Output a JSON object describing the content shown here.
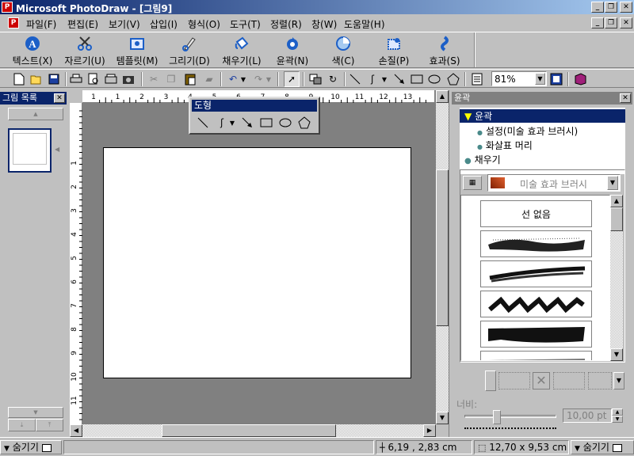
{
  "window": {
    "title": "Microsoft PhotoDraw - [그림9]",
    "app_icon_letter": "P"
  },
  "menu": {
    "items": [
      "파일(F)",
      "편집(E)",
      "보기(V)",
      "삽입(I)",
      "형식(O)",
      "도구(T)",
      "정렬(R)",
      "창(W)",
      "도움말(H)"
    ]
  },
  "big_toolbar": {
    "buttons": [
      {
        "label": "텍스트(X)",
        "icon": "text-A-icon"
      },
      {
        "label": "자르기(U)",
        "icon": "scissors-icon"
      },
      {
        "label": "템플릿(M)",
        "icon": "template-icon"
      },
      {
        "label": "그리기(D)",
        "icon": "pen-icon"
      },
      {
        "label": "채우기(L)",
        "icon": "paint-bucket-icon"
      },
      {
        "label": "윤곽(N)",
        "icon": "outline-icon"
      },
      {
        "label": "색(C)",
        "icon": "color-icon"
      },
      {
        "label": "손질(P)",
        "icon": "touchup-icon"
      },
      {
        "label": "효과(S)",
        "icon": "effects-icon"
      }
    ]
  },
  "std_toolbar": {
    "zoom": "81%"
  },
  "left_panel": {
    "title": "그림 목록"
  },
  "shapes_window": {
    "title": "도형"
  },
  "ruler": {
    "h_numbers": [
      "1",
      "1",
      "2",
      "3",
      "4",
      "5",
      "6",
      "7",
      "8",
      "9",
      "10",
      "11",
      "12",
      "13"
    ],
    "v_numbers": [
      "1",
      "2",
      "3",
      "4",
      "5",
      "6",
      "7",
      "8",
      "9",
      "10",
      "11"
    ]
  },
  "right_panel": {
    "title": "윤곽",
    "tree": {
      "root": "윤곽",
      "child1": "설정(미술 효과 브러시)",
      "child2": "화살표 머리",
      "fill": "채우기"
    },
    "brush_dropdown": "미술 효과 브러시",
    "brushes": {
      "none": "선 없음"
    },
    "width_label": "너비:",
    "width_value": "10,00 pt"
  },
  "status": {
    "left_toggle": "숨기기",
    "position": "6,19 , 2,83 cm",
    "size": "12,70 x 9,53 cm",
    "right_toggle": "숨기기"
  }
}
